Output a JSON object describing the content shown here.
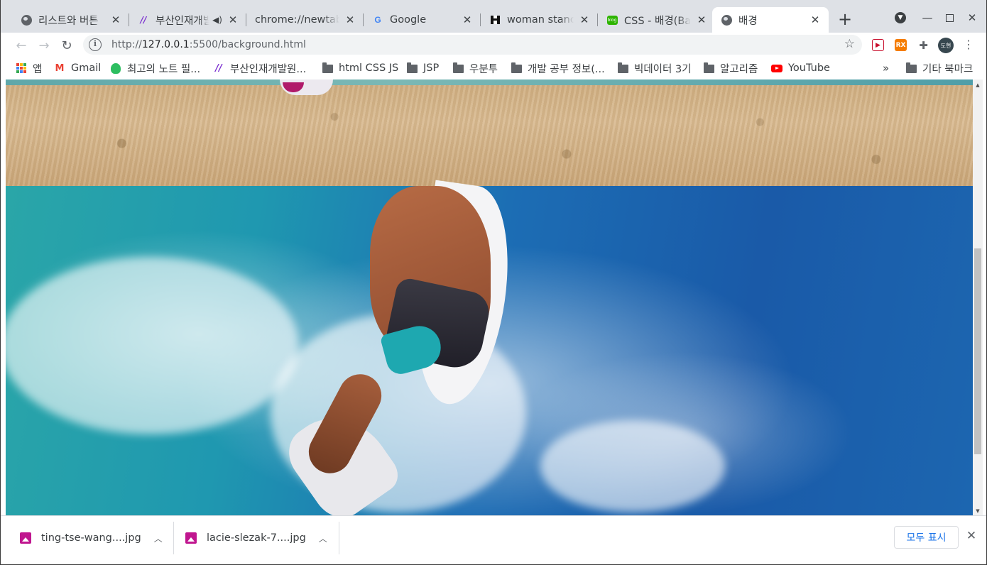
{
  "tabs": [
    {
      "title": "리스트와 버튼",
      "icon": "globe-icon"
    },
    {
      "title": "부산인재개발원",
      "icon": "slash-logo-icon"
    },
    {
      "title": "chrome://newtab",
      "icon": "none"
    },
    {
      "title": "Google",
      "icon": "google-icon"
    },
    {
      "title": "woman standing",
      "icon": "unsplash-icon"
    },
    {
      "title": "CSS - 배경(Background)",
      "icon": "blog-icon"
    },
    {
      "title": "배경",
      "icon": "globe-icon",
      "active": true
    }
  ],
  "toolbar": {
    "url_host": "127.0.0.1",
    "url_prefix": "http://",
    "url_rest": ":5500/background.html",
    "avatar_label": "도현"
  },
  "bookmarks": [
    {
      "label": "앱",
      "icon": "apps-grid-icon"
    },
    {
      "label": "Gmail",
      "icon": "gmail-icon"
    },
    {
      "label": "최고의 노트 필...",
      "icon": "evernote-icon"
    },
    {
      "label": "부산인재개발원...",
      "icon": "slash-logo-icon"
    },
    {
      "label": "html CSS JS",
      "icon": "folder-icon"
    },
    {
      "label": "JSP",
      "icon": "folder-icon"
    },
    {
      "label": "우분투",
      "icon": "folder-icon"
    },
    {
      "label": "개발 공부 정보(...",
      "icon": "folder-icon"
    },
    {
      "label": "빅데이터 3기",
      "icon": "folder-icon"
    },
    {
      "label": "알고리즘",
      "icon": "folder-icon"
    },
    {
      "label": "YouTube",
      "icon": "youtube-icon"
    }
  ],
  "bookmarks_overflow": "»",
  "other_bookmarks": "기타 북마크",
  "downloads": [
    {
      "filename": "ting-tse-wang....jpg"
    },
    {
      "filename": "lacie-slezak-7....jpg"
    }
  ],
  "shelf": {
    "show_all_label": "모두 표시"
  },
  "colors": {
    "accent": "#1a73e8",
    "tabstrip_bg": "#dee1e6",
    "file_icon": "#c0168f"
  }
}
